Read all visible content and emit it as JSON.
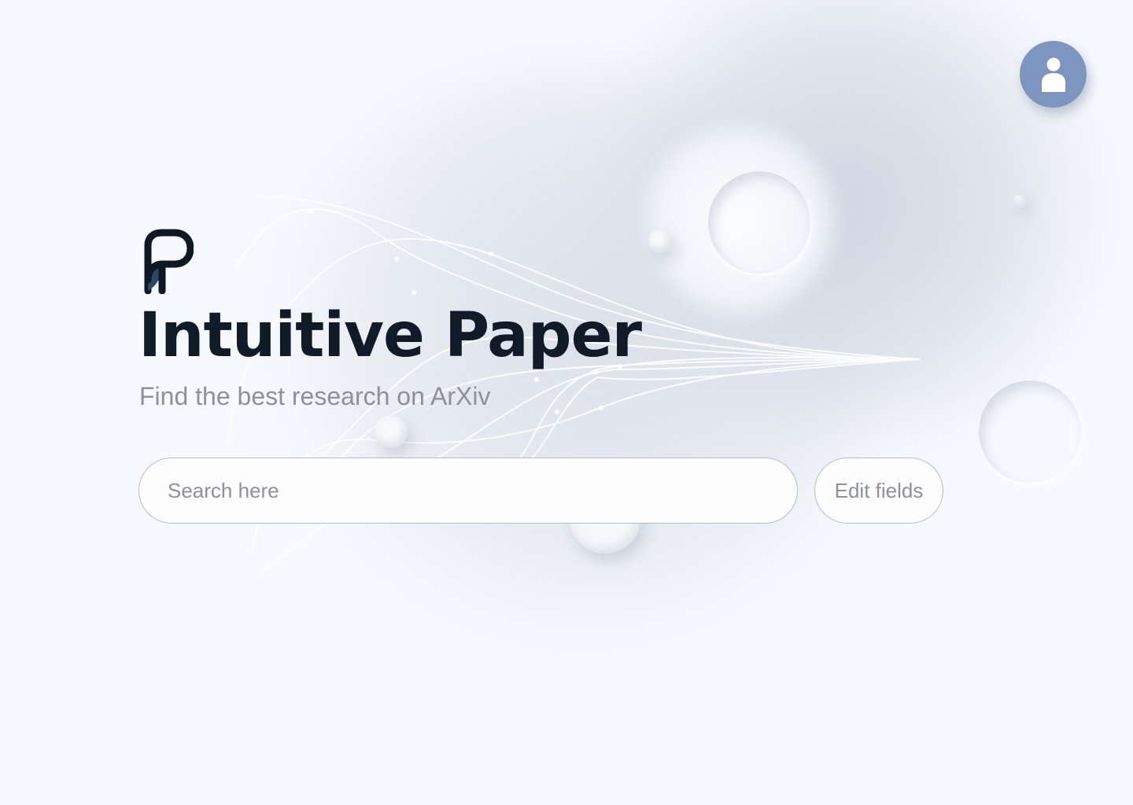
{
  "header": {
    "avatar_icon": "user-icon",
    "avatar_color": "#7e95c0"
  },
  "hero": {
    "logo_icon": "intuitive-paper-logo",
    "title": "Intuitive Paper",
    "subtitle": "Find the best research on ArXiv"
  },
  "search": {
    "placeholder": "Search here",
    "value": ""
  },
  "edit_fields": {
    "label": "Edit fields"
  },
  "colors": {
    "background": "#f6f9fd",
    "title": "#111b27",
    "muted_text": "#8e9196",
    "border": "#b9bcc2",
    "logo_accent": "#2a4a66"
  }
}
